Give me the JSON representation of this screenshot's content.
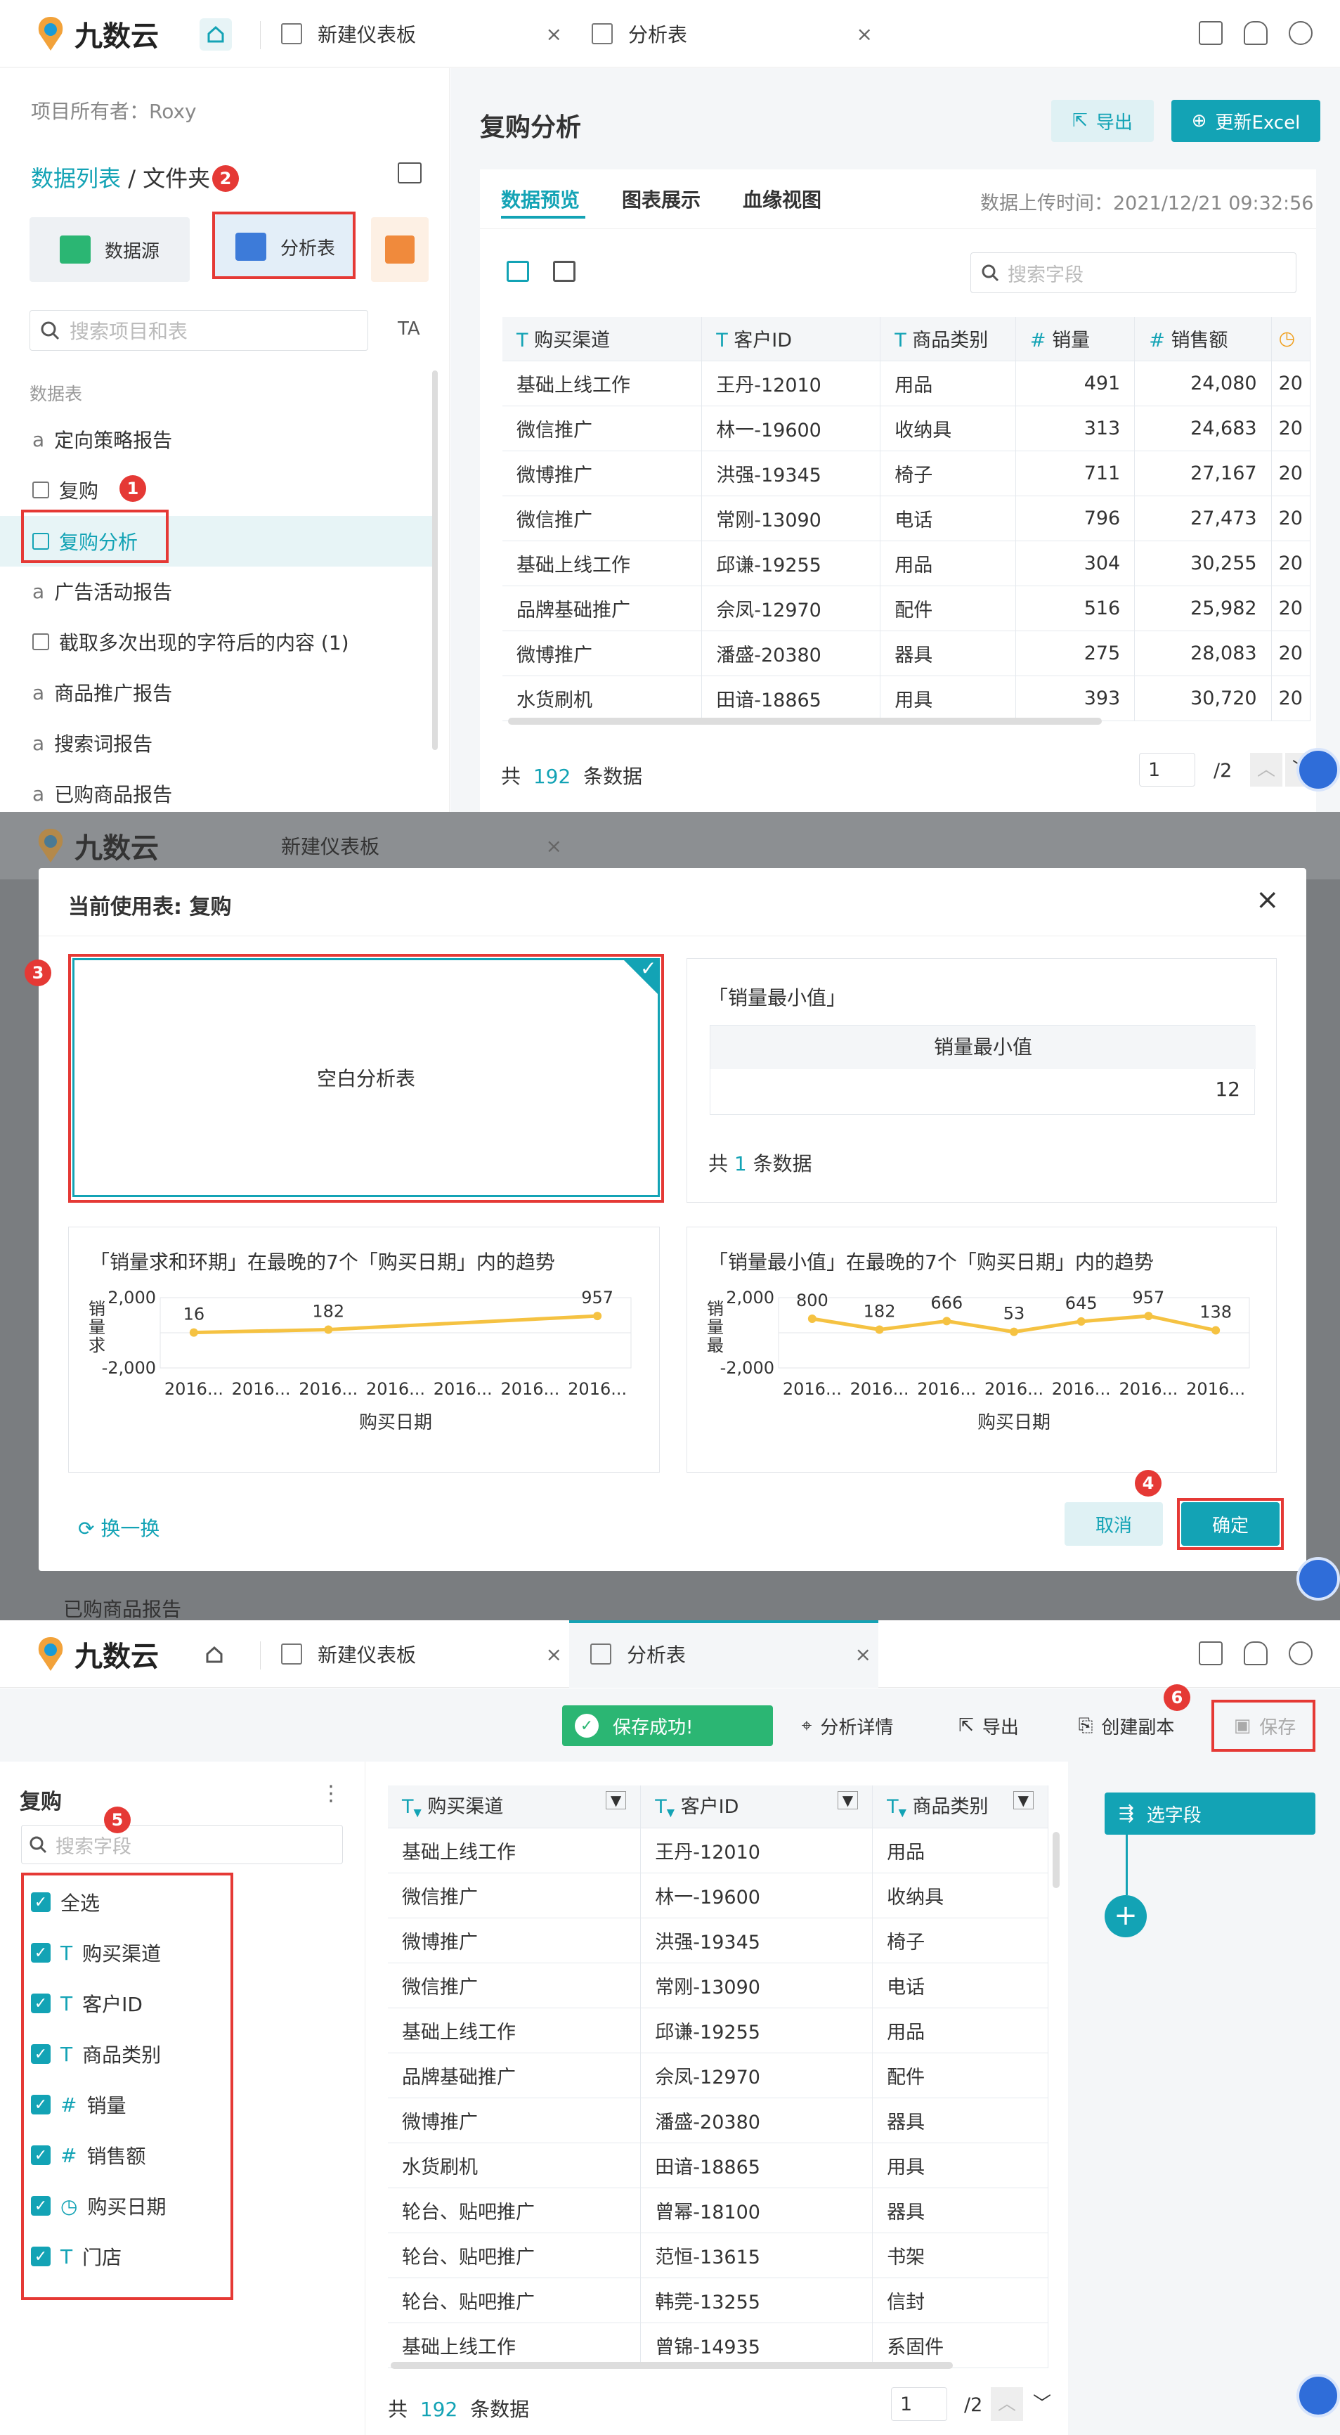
{
  "top": {
    "brand": "九数云",
    "tab1": "新建仪表板",
    "tab2": "分析表",
    "close": "×"
  },
  "p1": {
    "owner": "项目所有者：Roxy",
    "crumb_link": "数据列表",
    "crumb_rest": " / 文件夹",
    "btn_ds": "数据源",
    "btn_at": "分析表",
    "search_ph": "搜索项目和表",
    "section": "数据表",
    "items": [
      "定向策略报告",
      "复购",
      "复购分析",
      "广告活动报告",
      "截取多次出现的字符后的内容 (1)",
      "商品推广报告",
      "搜索词报告",
      "已购商品报告"
    ],
    "title": "复购分析",
    "export": "导出",
    "update": "更新Excel",
    "tabs": [
      "数据预览",
      "图表展示",
      "血缘视图"
    ],
    "upload": "数据上传时间：2021/12/21 09:32:56",
    "field_ph": "搜索字段",
    "cols": [
      "购买渠道",
      "客户ID",
      "商品类别",
      "销量",
      "销售额"
    ],
    "rows": [
      [
        "基础上线工作",
        "王丹-12010",
        "用品",
        "491",
        "24,080"
      ],
      [
        "微信推广",
        "林一-19600",
        "收纳具",
        "313",
        "24,683"
      ],
      [
        "微博推广",
        "洪强-19345",
        "椅子",
        "711",
        "27,167"
      ],
      [
        "微信推广",
        "常刚-13090",
        "电话",
        "796",
        "27,473"
      ],
      [
        "基础上线工作",
        "邱谦-19255",
        "用品",
        "304",
        "30,255"
      ],
      [
        "品牌基础推广",
        "佘凤-12970",
        "配件",
        "516",
        "25,982"
      ],
      [
        "微博推广",
        "潘盛-20380",
        "器具",
        "275",
        "28,083"
      ],
      [
        "水货刷机",
        "田谙-18865",
        "用具",
        "393",
        "30,720"
      ]
    ],
    "yr": "20",
    "total_pre": "共",
    "total": "192",
    "total_post": "条数据",
    "page": "1",
    "pages": "/2"
  },
  "p2": {
    "title": "当前使用表: 复购",
    "blank": "空白分析表",
    "card2_title": "「销量最小值」",
    "card2_col": "销量最小值",
    "card2_val": "12",
    "card2_total_pre": "共",
    "card2_total": "1",
    "card2_total_post": "条数据",
    "c3_title": "「销量求和环期」在最晚的7个「购买日期」内的趋势",
    "c4_title": "「销量最小值」在最晚的7个「购买日期」内的趋势",
    "c3_ylab": "销量求",
    "c4_ylab": "销量最",
    "c3_yt": [
      "2,000",
      "-2,000"
    ],
    "xlab": "购买日期",
    "xt": "2016...",
    "swap": "换一换",
    "cancel": "取消",
    "ok": "确定",
    "bg_item": "已购商品报告"
  },
  "chart_data": [
    {
      "type": "line",
      "title": "「销量求和环期」在最晚的7个「购买日期」内的趋势",
      "xlabel": "购买日期",
      "ylabel": "销量求",
      "ylim": [
        -2000,
        2000
      ],
      "categories": [
        "2016...",
        "2016...",
        "2016...",
        "2016...",
        "2016...",
        "2016...",
        "2016..."
      ],
      "labels": [
        {
          "i": 0,
          "v": "16"
        },
        {
          "i": 2,
          "v": "182"
        },
        {
          "i": 6,
          "v": "957"
        }
      ],
      "values": [
        16,
        null,
        182,
        null,
        null,
        null,
        957
      ]
    },
    {
      "type": "line",
      "title": "「销量最小值」在最晚的7个「购买日期」内的趋势",
      "xlabel": "购买日期",
      "ylabel": "销量最",
      "ylim": [
        -2000,
        2000
      ],
      "categories": [
        "2016...",
        "2016...",
        "2016...",
        "2016...",
        "2016...",
        "2016...",
        "2016..."
      ],
      "values": [
        800,
        182,
        666,
        53,
        645,
        957,
        138
      ]
    }
  ],
  "p3": {
    "saved": "保存成功!",
    "detail": "分析详情",
    "export": "导出",
    "copy": "创建副本",
    "save": "保存",
    "table": "复购",
    "field_ph": "搜索字段",
    "all": "全选",
    "fields": [
      {
        "t": "T",
        "n": "购买渠道"
      },
      {
        "t": "T",
        "n": "客户ID"
      },
      {
        "t": "T",
        "n": "商品类别"
      },
      {
        "t": "#",
        "n": "销量"
      },
      {
        "t": "#",
        "n": "销售额"
      },
      {
        "t": "◷",
        "n": "购买日期"
      },
      {
        "t": "T",
        "n": "门店"
      }
    ],
    "cols": [
      "购买渠道",
      "客户ID",
      "商品类别"
    ],
    "rows": [
      [
        "基础上线工作",
        "王丹-12010",
        "用品"
      ],
      [
        "微信推广",
        "林一-19600",
        "收纳具"
      ],
      [
        "微博推广",
        "洪强-19345",
        "椅子"
      ],
      [
        "微信推广",
        "常刚-13090",
        "电话"
      ],
      [
        "基础上线工作",
        "邱谦-19255",
        "用品"
      ],
      [
        "品牌基础推广",
        "佘凤-12970",
        "配件"
      ],
      [
        "微博推广",
        "潘盛-20380",
        "器具"
      ],
      [
        "水货刷机",
        "田谙-18865",
        "用具"
      ],
      [
        "轮台、贴吧推广",
        "曾幂-18100",
        "器具"
      ],
      [
        "轮台、贴吧推广",
        "范恒-13615",
        "书架"
      ],
      [
        "轮台、贴吧推广",
        "韩莞-13255",
        "信封"
      ],
      [
        "基础上线工作",
        "曾锦-14935",
        "系固件"
      ]
    ],
    "step": "选字段",
    "total_pre": "共",
    "total": "192",
    "total_post": "条数据",
    "page": "1",
    "pages": "/2"
  },
  "steps": [
    "1",
    "2",
    "3",
    "4",
    "5",
    "6"
  ],
  "colors": {
    "accent": "#13a3b5",
    "marker": "#e53935",
    "line": "#f5c242"
  }
}
